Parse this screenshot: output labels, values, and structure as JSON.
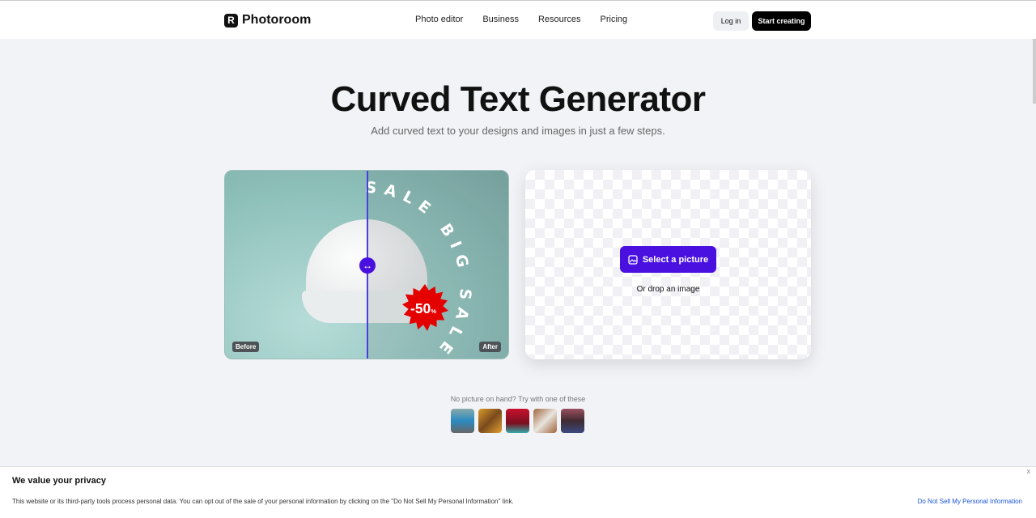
{
  "nav": {
    "brand": "Photoroom",
    "links": [
      "Photo editor",
      "Business",
      "Resources",
      "Pricing"
    ],
    "login": "Log in",
    "start": "Start creating"
  },
  "hero": {
    "title": "Curved Text Generator",
    "subtitle": "Add curved text to your designs and images in just a few steps."
  },
  "preview": {
    "curved_text": "SALE BIG SALE",
    "badge": "-50",
    "badge_unit": "%",
    "before": "Before",
    "after": "After",
    "accent": "#4a10e0",
    "badge_color": "#e50000"
  },
  "upload": {
    "select": "Select a picture",
    "drop": "Or drop an image"
  },
  "samples": {
    "label": "No picture on hand? Try with one of these",
    "thumbs": [
      "car",
      "shoe",
      "woman-red-hat",
      "notebook",
      "man-portrait"
    ]
  },
  "cookie": {
    "title": "We value your privacy",
    "text": "This website or its third-party tools process personal data. You can opt out of the sale of your personal information by clicking on the \"Do Not Sell My Personal Information\" link.",
    "link": "Do Not Sell My Personal Information",
    "close": "x"
  }
}
